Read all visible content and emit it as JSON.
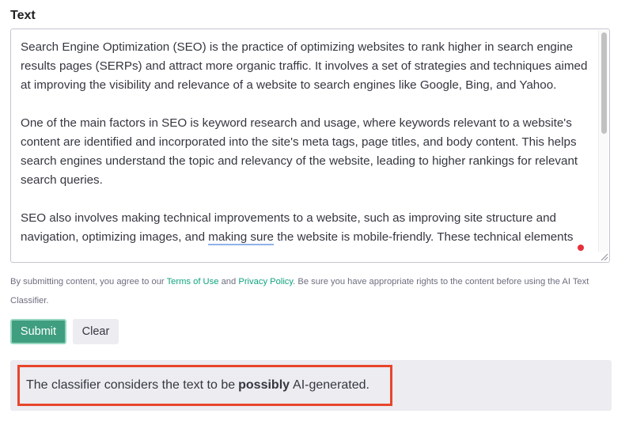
{
  "form": {
    "label": "Text",
    "text_paragraphs": [
      "Search Engine Optimization (SEO) is the practice of optimizing websites to rank higher in search engine results pages (SERPs) and attract more organic traffic. It involves a set of strategies and techniques aimed at improving the visibility and relevance of a website to search engines like Google, Bing, and Yahoo.",
      "One of the main factors in SEO is keyword research and usage, where keywords relevant to a website's content are identified and incorporated into the site's meta tags, page titles, and body content. This helps search engines understand the topic and relevancy of the website, leading to higher rankings for relevant search queries."
    ],
    "p3_part1": "SEO also involves making technical improvements to a website, such as improving site structure and navigation, optimizing images, and ",
    "p3_squiggle": "making sure",
    "p3_part2": " the website is mobile-friendly. These technical elements"
  },
  "disclaimer": {
    "prefix": "By submitting content, you agree to our ",
    "terms_link": "Terms of Use",
    "and": " and ",
    "privacy_link": "Privacy Policy",
    "suffix": ". Be sure you have appropriate rights to the content before using the AI Text Classifier."
  },
  "buttons": {
    "submit": "Submit",
    "clear": "Clear"
  },
  "result": {
    "prefix": "The classifier considers the text to be",
    "emphasis": "possibly",
    "suffix": "AI-generated."
  },
  "colors": {
    "accent": "#10a37f",
    "submit_bg": "#3f9e7f",
    "highlight_border": "#e8452c"
  }
}
